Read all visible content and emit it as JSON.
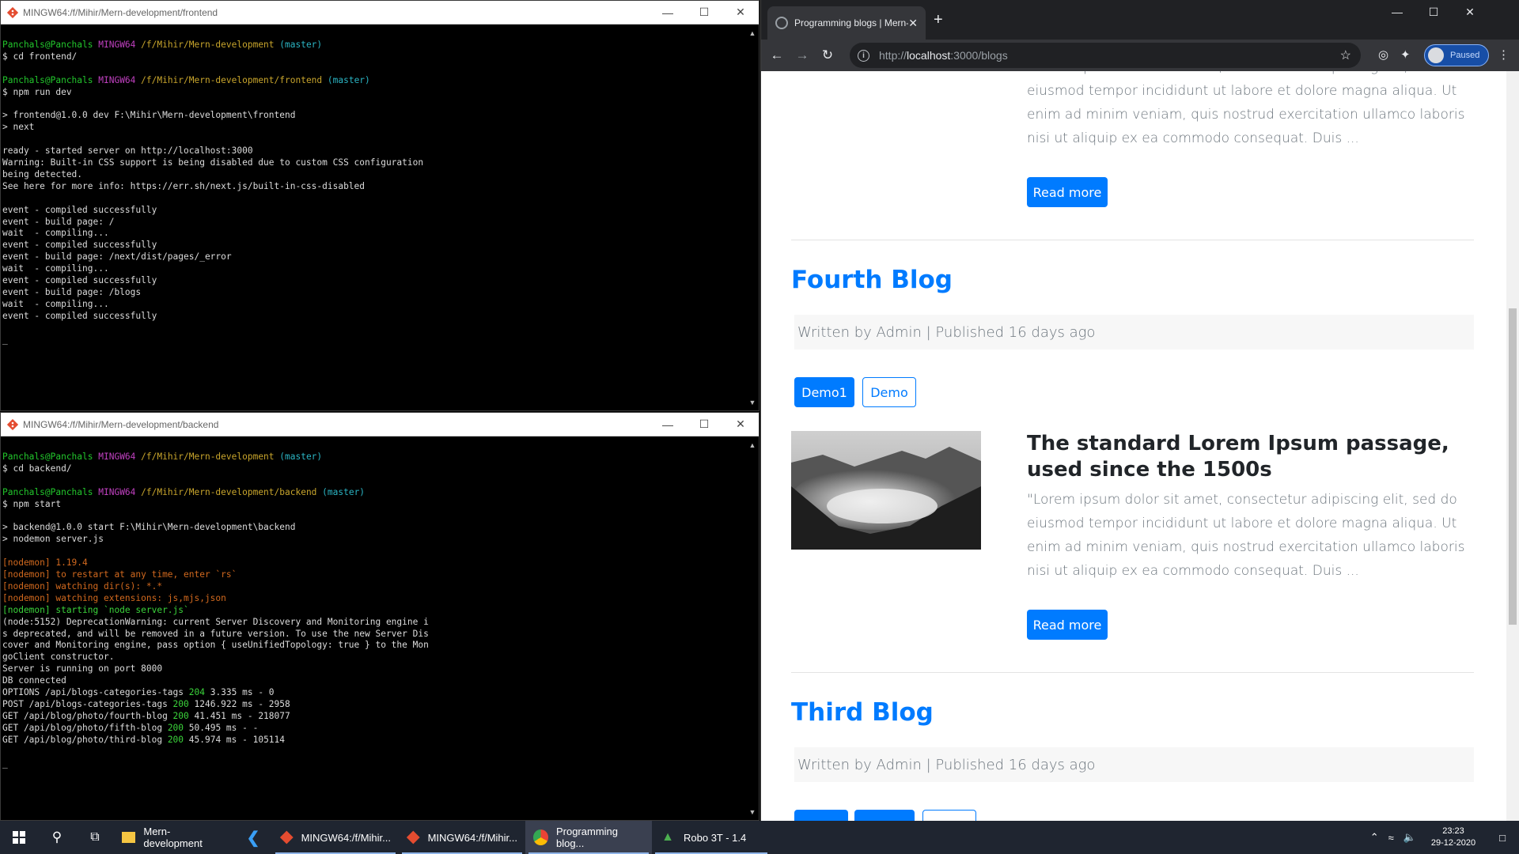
{
  "terminal_frontend": {
    "title": "MINGW64:/f/Mihir/Mern-development/frontend",
    "lines": [
      [
        [
          "Panchals@Panchals ",
          "g"
        ],
        [
          "MINGW64 ",
          "m"
        ],
        [
          "/f/Mihir/Mern-development ",
          "y"
        ],
        [
          "(master)",
          "c"
        ]
      ],
      [
        [
          "$ cd frontend/",
          ""
        ]
      ],
      [
        [
          "",
          ""
        ]
      ],
      [
        [
          "Panchals@Panchals ",
          "g"
        ],
        [
          "MINGW64 ",
          "m"
        ],
        [
          "/f/Mihir/Mern-development/frontend ",
          "y"
        ],
        [
          "(master)",
          "c"
        ]
      ],
      [
        [
          "$ npm run dev",
          ""
        ]
      ],
      [
        [
          "",
          ""
        ]
      ],
      [
        [
          "> frontend@1.0.0 dev F:\\Mihir\\Mern-development\\frontend",
          ""
        ]
      ],
      [
        [
          "> next",
          ""
        ]
      ],
      [
        [
          "",
          ""
        ]
      ],
      [
        [
          "ready - started server on http://localhost:3000",
          ""
        ]
      ],
      [
        [
          "Warning: Built-in CSS support is being disabled due to custom CSS configuration",
          ""
        ]
      ],
      [
        [
          "being detected.",
          ""
        ]
      ],
      [
        [
          "See here for more info: https://err.sh/next.js/built-in-css-disabled",
          ""
        ]
      ],
      [
        [
          "",
          ""
        ]
      ],
      [
        [
          "event - compiled successfully",
          ""
        ]
      ],
      [
        [
          "event - build page: /",
          ""
        ]
      ],
      [
        [
          "wait  - compiling...",
          ""
        ]
      ],
      [
        [
          "event - compiled successfully",
          ""
        ]
      ],
      [
        [
          "event - build page: /next/dist/pages/_error",
          ""
        ]
      ],
      [
        [
          "wait  - compiling...",
          ""
        ]
      ],
      [
        [
          "event - compiled successfully",
          ""
        ]
      ],
      [
        [
          "event - build page: /blogs",
          ""
        ]
      ],
      [
        [
          "wait  - compiling...",
          ""
        ]
      ],
      [
        [
          "event - compiled successfully",
          ""
        ]
      ],
      [
        [
          "",
          ""
        ]
      ],
      [
        [
          "_",
          ""
        ]
      ]
    ]
  },
  "terminal_backend": {
    "title": "MINGW64:/f/Mihir/Mern-development/backend",
    "lines": [
      [
        [
          "Panchals@Panchals ",
          "g"
        ],
        [
          "MINGW64 ",
          "m"
        ],
        [
          "/f/Mihir/Mern-development ",
          "y"
        ],
        [
          "(master)",
          "c"
        ]
      ],
      [
        [
          "$ cd backend/",
          ""
        ]
      ],
      [
        [
          "",
          ""
        ]
      ],
      [
        [
          "Panchals@Panchals ",
          "g"
        ],
        [
          "MINGW64 ",
          "m"
        ],
        [
          "/f/Mihir/Mern-development/backend ",
          "y"
        ],
        [
          "(master)",
          "c"
        ]
      ],
      [
        [
          "$ npm start",
          ""
        ]
      ],
      [
        [
          "",
          ""
        ]
      ],
      [
        [
          "> backend@1.0.0 start F:\\Mihir\\Mern-development\\backend",
          ""
        ]
      ],
      [
        [
          "> nodemon server.js",
          ""
        ]
      ],
      [
        [
          "",
          ""
        ]
      ],
      [
        [
          "[nodemon] 1.19.4",
          "o"
        ]
      ],
      [
        [
          "[nodemon] to restart at any time, enter `rs`",
          "o"
        ]
      ],
      [
        [
          "[nodemon] watching dir(s): *.*",
          "o"
        ]
      ],
      [
        [
          "[nodemon] watching extensions: js,mjs,json",
          "o"
        ]
      ],
      [
        [
          "[nodemon] starting `node server.js`",
          "lg"
        ]
      ],
      [
        [
          "(node:5152) DeprecationWarning: current Server Discovery and Monitoring engine i",
          ""
        ]
      ],
      [
        [
          "s deprecated, and will be removed in a future version. To use the new Server Dis",
          ""
        ]
      ],
      [
        [
          "cover and Monitoring engine, pass option { useUnifiedTopology: true } to the Mon",
          ""
        ]
      ],
      [
        [
          "goClient constructor.",
          ""
        ]
      ],
      [
        [
          "Server is running on port 8000",
          ""
        ]
      ],
      [
        [
          "DB connected",
          ""
        ]
      ],
      [
        [
          "OPTIONS /api/blogs-categories-tags ",
          ""
        ],
        [
          "204",
          "lg"
        ],
        [
          " 3.335 ms - 0",
          ""
        ]
      ],
      [
        [
          "POST /api/blogs-categories-tags ",
          ""
        ],
        [
          "200",
          "lg"
        ],
        [
          " 1246.922 ms - 2958",
          ""
        ]
      ],
      [
        [
          "GET /api/blog/photo/fourth-blog ",
          ""
        ],
        [
          "200",
          "lg"
        ],
        [
          " 41.451 ms - 218077",
          ""
        ]
      ],
      [
        [
          "GET /api/blog/photo/fifth-blog ",
          ""
        ],
        [
          "200",
          "lg"
        ],
        [
          " 50.495 ms - -",
          ""
        ]
      ],
      [
        [
          "GET /api/blog/photo/third-blog ",
          ""
        ],
        [
          "200",
          "lg"
        ],
        [
          " 45.974 ms - 105114",
          ""
        ]
      ],
      [
        [
          "",
          ""
        ]
      ],
      [
        [
          "_",
          ""
        ]
      ]
    ]
  },
  "browser": {
    "tab_title": "Programming blogs | Mern-Test",
    "url_prefix": "http://",
    "url_host": "localhost",
    "url_path": ":3000/blogs",
    "profile_label": "Paused"
  },
  "blog": {
    "top_excerpt": "\"Lorem ipsum dolor sit amet, consectetur adipiscing elit, sed do eiusmod tempor incididunt ut labore et dolore magna aliqua. Ut enim ad minim veniam, quis nostrud exercitation ullamco laboris nisi ut aliquip ex ea commodo consequat. Duis ...",
    "read_more": "Read more",
    "post1_title": "Fourth Blog",
    "post1_meta": "Written by Admin | Published 16 days ago",
    "post1_tags": [
      "Demo1",
      "Demo"
    ],
    "post1_heading": "The standard Lorem Ipsum passage, used since the 1500s",
    "post1_excerpt": "\"Lorem ipsum dolor sit amet, consectetur adipiscing elit, sed do eiusmod tempor incididunt ut labore et dolore magna aliqua. Ut enim ad minim veniam, quis nostrud exercitation ullamco laboris nisi ut aliquip ex ea commodo consequat. Duis ...",
    "post2_title": "Third Blog",
    "post2_meta": "Written by Admin | Published 16 days ago"
  },
  "taskbar": {
    "items": [
      "Mern-development",
      "MINGW64:/f/Mihir...",
      "MINGW64:/f/Mihir...",
      "Programming blog...",
      "Robo 3T - 1.4"
    ],
    "time": "23:23",
    "date": "29-12-2020"
  },
  "colors": {
    "accent": "#007bff",
    "terminal_green": "#22c72c",
    "taskbar": "#1f2530"
  }
}
